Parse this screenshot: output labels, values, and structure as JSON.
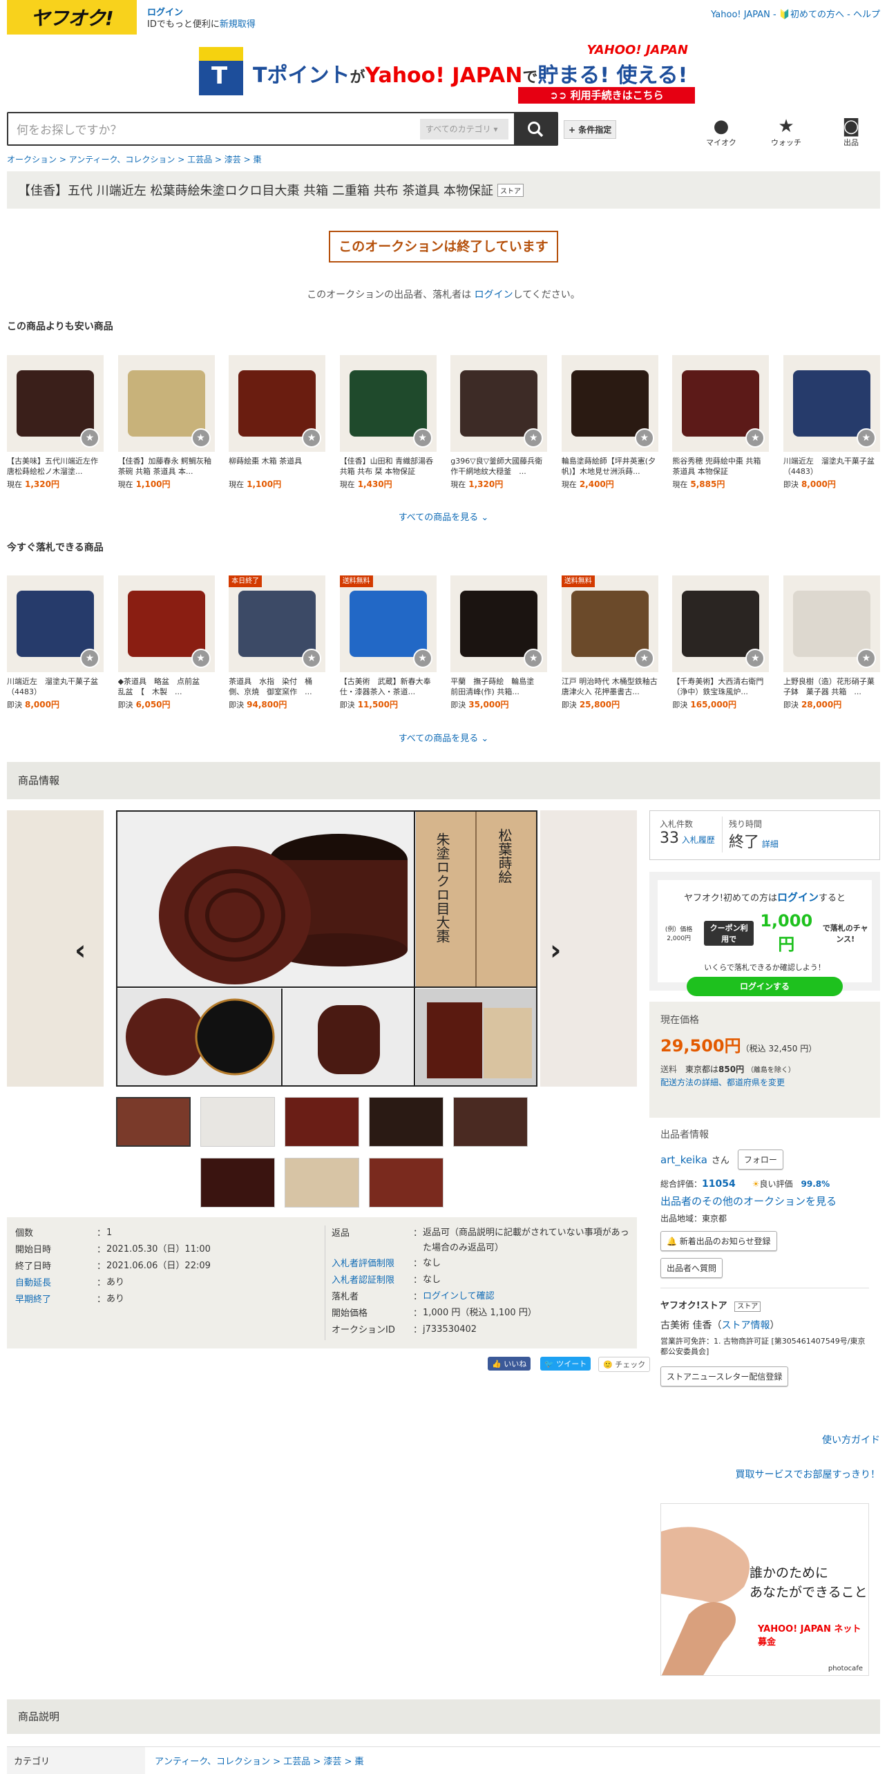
{
  "header": {
    "logo": "ヤフオク!",
    "login": "ログイン",
    "login_sub": "IDでもっと便利に",
    "register": "新規取得",
    "right_links": "Yahoo! JAPAN - 🔰初めての方へ - ヘルプ"
  },
  "banner": {
    "main_a": "Tポイント",
    "main_b": "が",
    "main_c": "Yahoo! JAPAN",
    "main_d": "で",
    "main_e": "貯まる! 使える!",
    "logo": "YAHOO! JAPAN",
    "cta": "➲➲ 利用手続きはこちら"
  },
  "search": {
    "placeholder": "何をお探しですか？",
    "category": "すべてのカテゴリ",
    "button_icon": "search-icon",
    "conditions": "+ 条件指定"
  },
  "header_icons": [
    {
      "label": "マイオク",
      "icon": "user-icon"
    },
    {
      "label": "ウォッチ",
      "icon": "star-icon"
    },
    {
      "label": "出品",
      "icon": "camera-icon"
    }
  ],
  "breadcrumb": "オークション > アンティーク、コレクション > 工芸品 > 漆芸 > 棗",
  "title": "【佳香】五代 川端近左 松葉蒔絵朱塗ロクロ目大棗 共箱 二重箱 共布 茶道具 本物保証",
  "store_tag": "ストア",
  "ended": "このオークションは終了しています",
  "end_note_a": "このオークションの出品者、落札者は ",
  "end_note_link": "ログイン",
  "end_note_b": "してください。",
  "cheaper": {
    "heading": "この商品よりも安い商品",
    "see_all": "すべての商品を見る ⌄",
    "items": [
      {
        "name": "【古美味】五代川端近左作 唐松蒔絵松ノ木溜塗...",
        "price_label": "現在",
        "price": "1,320円",
        "color": "#3a1f1a"
      },
      {
        "name": "【佳香】加藤春永 鰐鯛灰釉茶碗 共箱 茶道具 本...",
        "price_label": "現在",
        "price": "1,100円",
        "color": "#c8b27a"
      },
      {
        "name": "柳蒔絵棗 木箱 茶道具",
        "price_label": "現在",
        "price": "1,100円",
        "color": "#6a1d10"
      },
      {
        "name": "【佳香】山田和 青織部湯呑 共箱 共布 栞 本物保証",
        "price_label": "現在",
        "price": "1,430円",
        "color": "#1f4a2c"
      },
      {
        "name": "g396▽良▽釜師大國藤兵衛作干網地紋大穏釜　...",
        "price_label": "現在",
        "price": "1,320円",
        "color": "#3d2b26"
      },
      {
        "name": "輪島塗蒔絵師【坪井英憲(夕帆)】木地見せ洲浜蒔...",
        "price_label": "現在",
        "price": "2,400円",
        "color": "#2a1a12"
      },
      {
        "name": "熊谷秀穂 兜蒔絵中棗 共箱 茶道具 本物保証",
        "price_label": "現在",
        "price": "5,885円",
        "color": "#5c1a18"
      },
      {
        "name": "川端近左　溜塗丸干菓子盆　（4483）",
        "price_label": "即決",
        "price": "8,000円",
        "color": "#263b6b"
      }
    ]
  },
  "buynow": {
    "heading": "今すぐ落札できる商品",
    "see_all": "すべての商品を見る ⌄",
    "items": [
      {
        "name": "川端近左　溜塗丸干菓子盆　（4483）",
        "price_label": "即決",
        "price": "8,000円",
        "tag": "",
        "color": "#263b6b"
      },
      {
        "name": "◆茶道具　略盆　点前盆　乱盆　【　木製　...",
        "price_label": "即決",
        "price": "6,050円",
        "tag": "",
        "color": "#8a1e12"
      },
      {
        "name": "茶道具　水指　染付　桶側、京焼　御室窯作　...",
        "price_label": "即決",
        "price": "94,800円",
        "tag": "本日終了",
        "color": "#3c4a66"
      },
      {
        "name": "【古美術　武蔵】新春大奉仕・漆器茶入・茶道...",
        "price_label": "即決",
        "price": "11,500円",
        "tag": "送料無料",
        "color": "#2268c6"
      },
      {
        "name": "平蘭　撫子蒔絵　輪島塗　前田清峰(作) 共箱...",
        "price_label": "即決",
        "price": "35,000円",
        "tag": "",
        "color": "#1b1411"
      },
      {
        "name": "江戸 明治時代 木桶型鉄釉古唐津火入 花押墨書古...",
        "price_label": "即決",
        "price": "25,800円",
        "tag": "送料無料",
        "color": "#6b4a2a"
      },
      {
        "name": "【千寿美術】大西清右衛門（浄中）鉄宝珠風炉...",
        "price_label": "即決",
        "price": "165,000円",
        "tag": "",
        "color": "#2a2522"
      },
      {
        "name": "上野良樹（造）花形硝子菓子鉢　菓子器 共箱　...",
        "price_label": "即決",
        "price": "28,000円",
        "tag": "",
        "color": "#ddd8cf"
      }
    ]
  },
  "product_info_heading": "商品情報",
  "gallery": {
    "label_a": "松葉蒔絵",
    "label_b": "朱塗ロクロ目大棗",
    "prev_icon": "chevron-left-icon",
    "next_icon": "chevron-right-icon"
  },
  "details_left": [
    {
      "k": "個数",
      "v": "1",
      "link": false
    },
    {
      "k": "開始日時",
      "v": "2021.05.30（日）11:00",
      "link": false
    },
    {
      "k": "終了日時",
      "v": "2021.06.06（日）22:09",
      "link": false
    },
    {
      "k": "自動延長",
      "v": "あり",
      "link": true
    },
    {
      "k": "早期終了",
      "v": "あり",
      "link": true
    }
  ],
  "details_right": [
    {
      "k": "返品",
      "v": "返品可（商品説明に記載がされていない事項があった場合のみ返品可）",
      "link": false
    },
    {
      "k": "入札者評価制限",
      "v": "なし",
      "link": true
    },
    {
      "k": "入札者認証制限",
      "v": "なし",
      "link": true
    },
    {
      "k": "落札者",
      "v": "ログインして確認",
      "link": false
    },
    {
      "k": "開始価格",
      "v": "1,000 円（税込 1,100 円）",
      "link": false
    },
    {
      "k": "オークションID",
      "v": "j733530402",
      "link": false
    }
  ],
  "social": {
    "like": "👍 いいね",
    "tweet": "🐦 ツイート",
    "check": "🙂 チェック"
  },
  "bid": {
    "count_label": "入札件数",
    "count": "33",
    "history": "入札履歴",
    "time_label": "残り時間",
    "time": "終了",
    "detail": "詳細"
  },
  "login_promo": {
    "line1_a": "ヤフオク!初めての方は",
    "line1_link": "ログイン",
    "line1_b": "すると",
    "example": "(例）価格2,000円",
    "coupon": "クーポン利用で",
    "amount": "1,000円",
    "suffix": "で落札のチャンス!",
    "note": "いくらで落札できるか確認しよう！",
    "button": "ログインする"
  },
  "price": {
    "label": "現在価格",
    "amount": "29,500円",
    "tax": "（税込 32,450 円）",
    "ship_label": "送料",
    "ship_area": "東京都は",
    "ship_val": "850円",
    "ship_note": "（離島を除く）",
    "ship_link": "配送方法の詳細、都道府県を変更"
  },
  "seller": {
    "heading": "出品者情報",
    "name": "art_keika",
    "suffix": "さん",
    "follow": "フォロー",
    "rating_label": "総合評価：",
    "rating": "11054",
    "good_label": "良い評価",
    "good": "99.8%",
    "other": "出品者のその他のオークションを見る",
    "region": "出品地域：東京都",
    "notify": "🔔 新着出品のお知らせ登録",
    "question": "出品者へ質問",
    "store_heading": "ヤフオク!ストア",
    "store_name": "古美術 佳香",
    "store_info": "ストア情報",
    "license": "営業許可免許：1. 古物商許可証 [第305461407549号/東京都公安委員会]",
    "newsletter": "ストアニュースレター配信登録"
  },
  "guide": "使い方ガイド",
  "purchase_link": "買取サービスでお部屋すっきり！",
  "ad": {
    "line1": "誰かのために",
    "line2": "あなたができること",
    "brand": "YAHOO! JAPAN ネット募金",
    "credit": "photocafe"
  },
  "desc_heading": "商品説明",
  "category_label": "カテゴリ",
  "category_value": "アンティーク、コレクション > 工芸品 > 漆芸 > 棗"
}
